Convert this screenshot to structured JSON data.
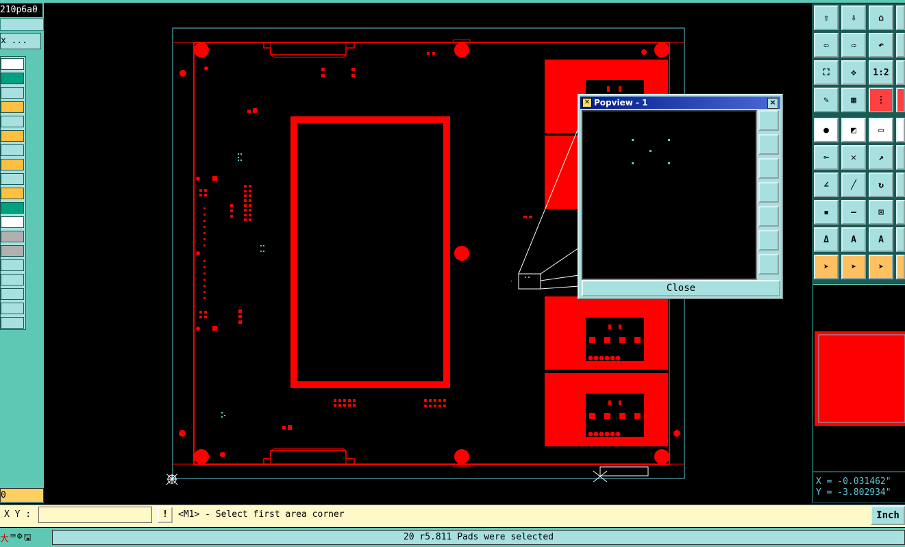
{
  "app": {
    "left_title": "210p6a0",
    "left_button": "x ...",
    "left_status": "0"
  },
  "layers": {
    "colors": [
      "#ffffff",
      "#00a080",
      "#a8e0e0",
      "#ffc040",
      "#a8e0e0",
      "#ffc040",
      "#a8e0e0",
      "#ffc040",
      "#a8e0e0",
      "#ffc040",
      "#00a080",
      "#ffffff",
      "#b0b0b0",
      "#b0b0b0",
      "#a8e0e0",
      "#a8e0e0",
      "#a8e0e0",
      "#a8e0e0",
      "#a8e0e0"
    ]
  },
  "popview": {
    "title": "Popview - 1",
    "close_label": "Close",
    "close_x": "×"
  },
  "coords": {
    "x": "X = -0.031462\"",
    "y": "Y = -3.802934\""
  },
  "command": {
    "xy_label": "X Y :",
    "xy_value": "",
    "excl": "!",
    "prompt": "<M1> - Select first area corner",
    "unit": "Inch"
  },
  "status": {
    "message": "20 r5.811 Pads were selected",
    "icons": [
      "大",
      "⌨",
      "⚙",
      "🖫"
    ]
  },
  "toolbar_labels": {
    "scale": "1:2"
  },
  "colors": {
    "board": "#ff0000",
    "outline": "#5fc8d8",
    "panel": "#5fc8b4"
  }
}
